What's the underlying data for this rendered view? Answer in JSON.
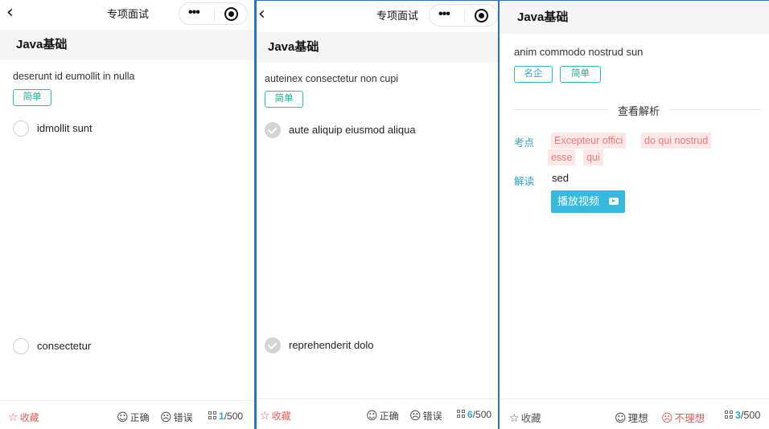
{
  "nav": {
    "back_icon": "‹",
    "title": "专项面试",
    "menu_icon": "•••"
  },
  "section": "Java基础",
  "panel1": {
    "stem": "deserunt id eumollit in nulla",
    "tag": "简单",
    "options": [
      "idmollit sunt",
      "consectetur"
    ]
  },
  "panel2": {
    "stem": "auteinex consectetur non cupi",
    "tag": "简单",
    "options": [
      "aute aliquip eiusmod aliqua",
      "reprehenderit dolo"
    ]
  },
  "panel3": {
    "stem": "anim commodo nostrud sun",
    "tags": [
      "名企",
      "简单"
    ],
    "divider": "查看解析",
    "kaodian_label": "考点",
    "kaodian": [
      "Excepteur offici",
      "do qui nostrud",
      "esse",
      "qui"
    ],
    "jiedu_label": "解读",
    "jiedu": "sed",
    "video_button": "播放视频"
  },
  "footer1": {
    "fav": "收藏",
    "correct": "正确",
    "wrong": "错误",
    "current": "1",
    "total": "/500"
  },
  "footer2": {
    "fav": "收藏",
    "correct": "正确",
    "wrong": "错误",
    "current": "6",
    "total": "/500"
  },
  "footer3": {
    "fav": "收藏",
    "good": "理想",
    "bad": "不理想",
    "current": "3",
    "total": "/500"
  },
  "colors": {
    "accent": "#2aa6c8",
    "tag_green": "#1fae91",
    "favorite_red": "#e45c5c",
    "divider_blue": "#2a73c8"
  }
}
